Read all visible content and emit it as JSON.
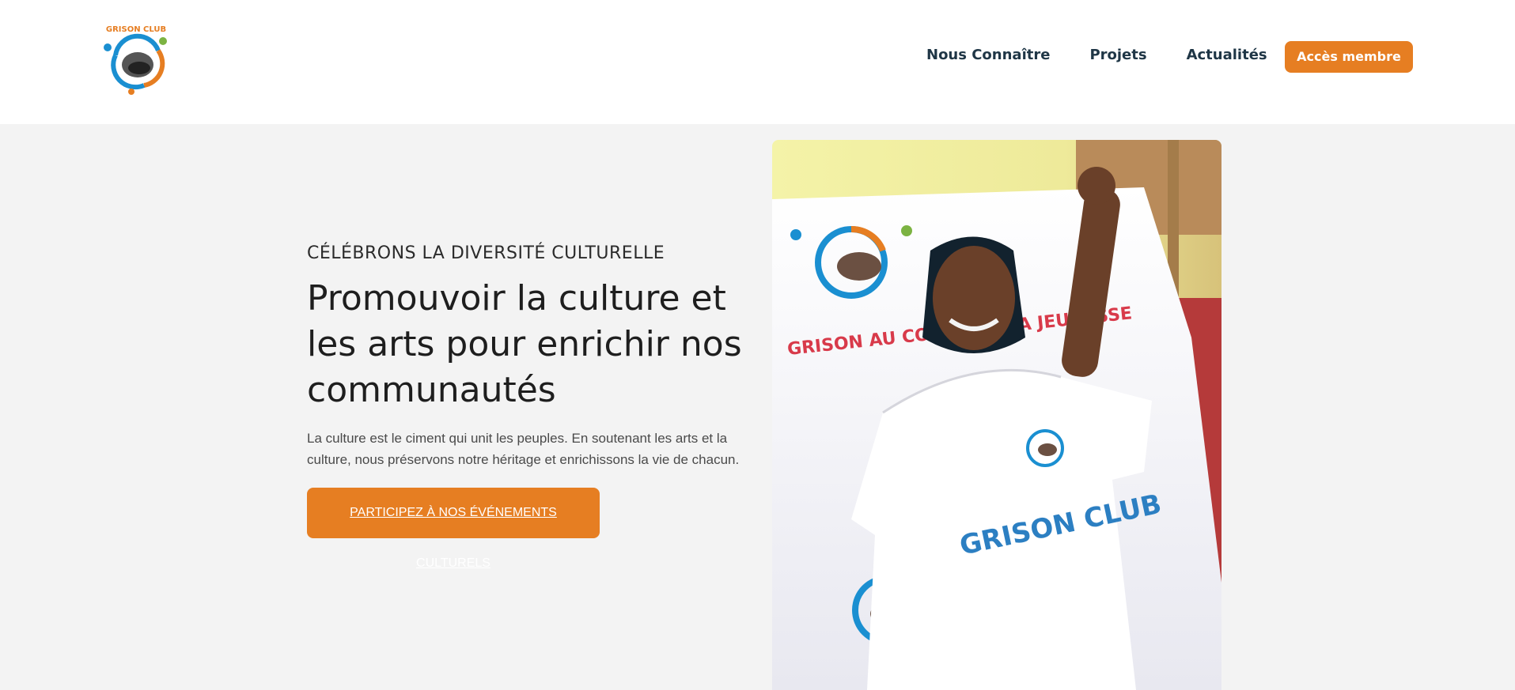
{
  "header": {
    "logo_alt": "GRISON CLUB",
    "nav": [
      {
        "label": "Nous Connaître"
      },
      {
        "label": "Projets"
      },
      {
        "label": "Actualités"
      }
    ],
    "member_button": "Accès membre"
  },
  "hero": {
    "eyebrow": "CÉLÉBRONS LA DIVERSITÉ CULTURELLE",
    "title_line1": "Promouvoir la culture et",
    "title_line2": "les arts pour enrichir nos",
    "title_line3": "communautés",
    "lead": "La culture est le ciment qui unit les peuples. En soutenant les arts et la culture, nous préservons notre héritage et enrichissons la vie de chacun.",
    "cta": "PARTICIPEZ À NOS ÉVÉNEMENTS CULTURELS"
  },
  "photo": {
    "banner_text": "GRISON AU COEUR DE LA JEUNESSE",
    "shirt_text": "GRISON CLUB",
    "logo_text": "GRISON CLUB"
  },
  "colors": {
    "accent": "#e67e22",
    "nav_text": "#1f3646",
    "background": "#f3f3f3"
  }
}
